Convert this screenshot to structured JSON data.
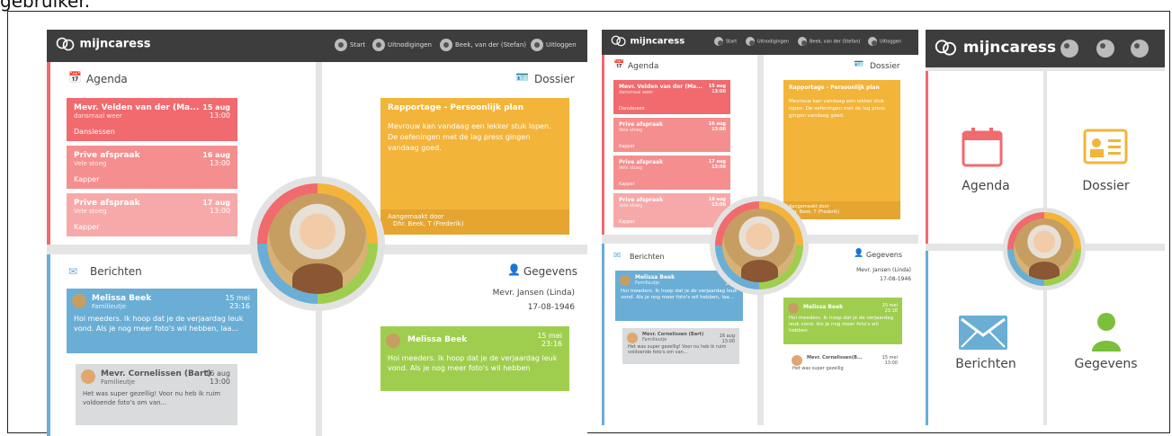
{
  "caption": "gebruiker.",
  "brand": "mijncaress",
  "nav": {
    "start": "Start",
    "uitnodigingen": "Uitnodigingen",
    "user": "Beek, van der (Stefan)",
    "uitloggen": "Uitloggen"
  },
  "agenda": {
    "title": "Agenda",
    "items": [
      {
        "title": "Mevr. Velden van der (Ma...",
        "sub": "dansmaal weer",
        "note": "Danslessen",
        "date": "15 aug",
        "time": "13:00"
      },
      {
        "title": "Prive afspraak",
        "sub": "Vele stoeg",
        "note": "Kapper",
        "date": "16 aug",
        "time": "13:00"
      },
      {
        "title": "Prive afspraak",
        "sub": "Vele stoeg",
        "note": "Kapper",
        "date": "17 aug",
        "time": "13:00"
      }
    ],
    "item4": {
      "title": "Prive afspraak",
      "sub": "Vele stoeg",
      "note": "Kapper",
      "date": "18 aug",
      "time": "13:00"
    }
  },
  "dossier": {
    "title": "Dossier",
    "card_title": "Rapportage - Persoonlijk plan",
    "card_text": "Mevrouw kan vandaag een lekker stuk lopen. De oefeningen met de lag press gingen vandaag goed.",
    "footer_label": "Aangemaakt door",
    "footer_name": "Dhr. Beek, T (Frederik)"
  },
  "berichten": {
    "title": "Berichten",
    "msg1": {
      "name": "Melissa Beek",
      "tag": "Familieutje",
      "date": "15 mei",
      "time": "23:16",
      "text": "Hoi meeders. Ik hoop dat je de verjaardag leuk vond. Als je nog meer foto's wil hebben, laa..."
    },
    "msg2": {
      "name": "Mevr. Cornelissen (Bart)",
      "tag": "Familieutje",
      "date": "16 aug",
      "time": "13:00",
      "text": "Het was super gezellig! Voor nu heb ik ruim voldoende foto's om van..."
    }
  },
  "gegevens": {
    "title": "Gegevens",
    "name": "Mevr. Jansen (Linda)",
    "dob": "17-08-1946",
    "msg": {
      "name": "Melissa Beek",
      "date": "15 mei",
      "time": "23:16",
      "text": "Hoi meeders. Ik hoop dat je de verjaardag leuk vond. Als je nog meer foto's wil hebben"
    },
    "msg2": {
      "name": "Mevr. Cornelissen(B...",
      "date": "15 mei",
      "time": "13:00",
      "text": "Het was super gezellig"
    }
  },
  "tiles": {
    "agenda": "Agenda",
    "dossier": "Dossier",
    "berichten": "Berichten",
    "gegevens": "Gegevens"
  },
  "colors": {
    "red": "#f06a6e",
    "red2": "#f58e8e",
    "red3": "#f7a9a9",
    "yellow": "#f3b43a",
    "blue": "#6aaed6",
    "green": "#9fce4f",
    "gray": "#d9dbdc",
    "dark": "#3d3d3d"
  }
}
